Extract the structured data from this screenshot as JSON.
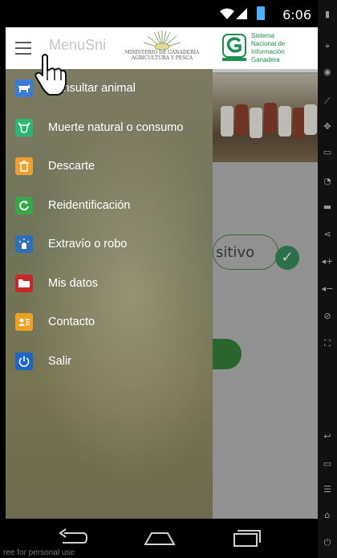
{
  "status_bar": {
    "time": "6:06"
  },
  "header": {
    "title": "MenuSni",
    "ministerio_text": "MINISTERIO DE GANADERÍA AGRICULTURA Y PESCA",
    "snig_text_line1": "Sistema",
    "snig_text_line2": "Nacional de",
    "snig_text_line3": "Información",
    "snig_text_line4": "Ganadera"
  },
  "menu": {
    "items": [
      {
        "label": "Consultar animal",
        "icon": "cow-icon",
        "color": "#3a7bd5"
      },
      {
        "label": "Muerte natural o consumo",
        "icon": "cow-head-icon",
        "color": "#2bb673"
      },
      {
        "label": "Descarte",
        "icon": "trash-icon",
        "color": "#f0a030"
      },
      {
        "label": "Reidentificación",
        "icon": "refresh-icon",
        "color": "#3aa64a"
      },
      {
        "label": "Extravío o robo",
        "icon": "alert-light-icon",
        "color": "#2f6fb5"
      },
      {
        "label": "Mis datos",
        "icon": "folder-icon",
        "color": "#c62828"
      },
      {
        "label": "Contacto",
        "icon": "contact-card-icon",
        "color": "#f0a020"
      },
      {
        "label": "Salir",
        "icon": "power-icon",
        "color": "#1e63c6"
      }
    ]
  },
  "background_app": {
    "field_text": "sitivo"
  },
  "watermark": "ree for personal use"
}
